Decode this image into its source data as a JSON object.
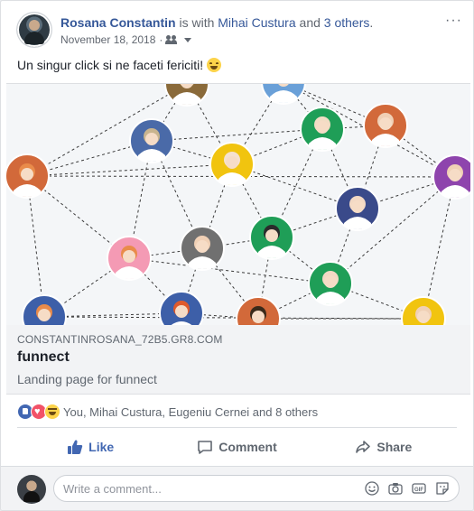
{
  "post": {
    "author": "Rosana Constantin",
    "with_text": " is with ",
    "tagged": "Mihai Custura",
    "and_text": " and ",
    "others": "3 others",
    "period": ".",
    "date": "November 18, 2018",
    "separator": "·",
    "privacy_icon": "friends-icon",
    "more_label": "···",
    "message": "Un singur click si ne faceti fericiti!",
    "message_emoji": "grinning-sweat-emoji"
  },
  "link_preview": {
    "domain": "CONSTANTINROSANA_72B5.GR8.COM",
    "title": "funnect",
    "description": "Landing page for funnect"
  },
  "reactions": {
    "icons": [
      "like-icon",
      "love-icon",
      "haha-icon"
    ],
    "summary": "You, Mihai Custura, Eugeniu Cernei and 8 others"
  },
  "actions": {
    "like": "Like",
    "comment": "Comment",
    "share": "Share"
  },
  "comment_box": {
    "placeholder": "Write a comment...",
    "icons": [
      "emoji-icon",
      "camera-icon",
      "gif-icon",
      "sticker-icon"
    ]
  },
  "colors": {
    "link_blue": "#365899",
    "like_blue": "#4267b2",
    "meta_gray": "#606770"
  }
}
